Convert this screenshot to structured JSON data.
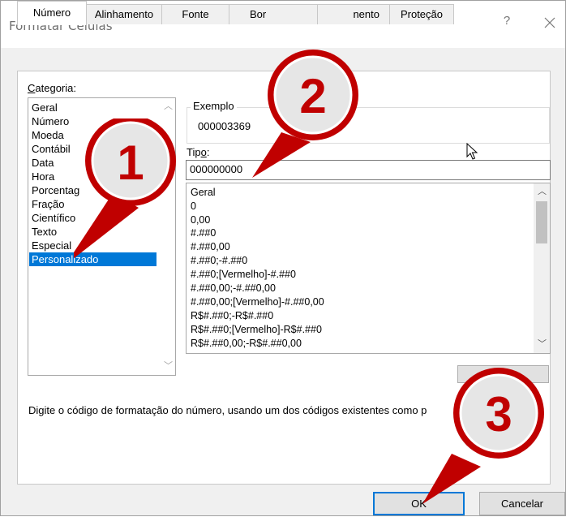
{
  "dialog": {
    "title": "Formatar Células",
    "help": "?",
    "tabs": [
      {
        "label": "Número"
      },
      {
        "label": "Alinhamento"
      },
      {
        "label": "Fonte"
      },
      {
        "label": "Bor"
      },
      {
        "label": "nento"
      },
      {
        "label": "Proteção"
      }
    ]
  },
  "categoria": {
    "label_underlined": "C",
    "label_rest": "ategoria:",
    "items": [
      "Geral",
      "Número",
      "Moeda",
      "Contábil",
      "Data",
      "Hora",
      "Porcentag",
      "Fração",
      "Científico",
      "Texto",
      "Especial",
      "Personalizado"
    ],
    "selected_index": 11
  },
  "exemplo": {
    "legend": "Exemplo",
    "value": "000003369"
  },
  "tipo": {
    "label_a": "Tip",
    "label_underlined": "o",
    "label_b": ":",
    "value": "000000000",
    "formats": [
      "Geral",
      "0",
      "0,00",
      "#.##0",
      "#.##0,00",
      "#.##0;-#.##0",
      "#.##0;[Vermelho]-#.##0",
      "#.##0,00;-#.##0,00",
      "#.##0,00;[Vermelho]-#.##0,00",
      "R$#.##0;-R$#.##0",
      "R$#.##0;[Vermelho]-R$#.##0",
      "R$#.##0,00;-R$#.##0,00"
    ]
  },
  "hint": "Digite o código de formatação do número, usando um dos códigos existentes como p",
  "buttons": {
    "ok": "OK",
    "cancel": "Cancelar"
  },
  "callouts": [
    "1",
    "2",
    "3"
  ],
  "colors": {
    "accent": "#0078d7",
    "callout_red": "#c00000",
    "callout_fill": "#e6e6e6"
  }
}
